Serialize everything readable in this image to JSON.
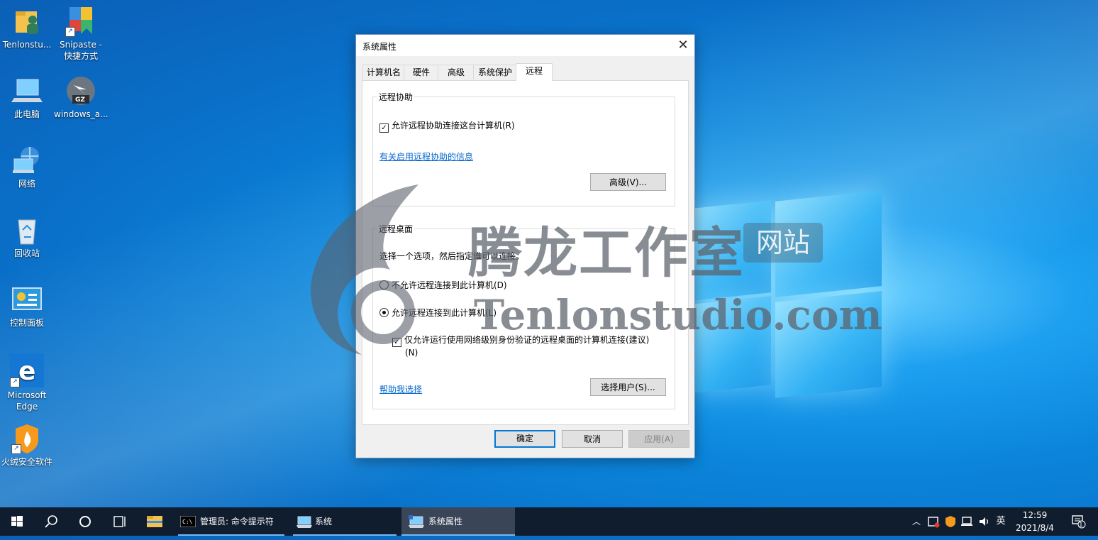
{
  "desktop": {
    "icons": [
      {
        "label": "Tenlonstu...",
        "icon": "user-folder-icon"
      },
      {
        "label": "Snipaste -\n快捷方式",
        "icon": "snipaste-icon"
      },
      {
        "label": "此电脑",
        "icon": "this-pc-icon"
      },
      {
        "label": "windows_a...",
        "icon": "gz-archive-icon"
      },
      {
        "label": "网络",
        "icon": "network-icon"
      },
      {
        "label": "回收站",
        "icon": "recycle-bin-icon"
      },
      {
        "label": "控制面板",
        "icon": "control-panel-icon"
      },
      {
        "label": "Microsoft\nEdge",
        "icon": "edge-icon"
      },
      {
        "label": "火绒安全软件",
        "icon": "huorong-icon"
      }
    ],
    "archive_badge": "GZ"
  },
  "watermark": {
    "chinese": "腾龙工作室",
    "badge": "网站",
    "english": "Tenlonstudio.com"
  },
  "dialog": {
    "title": "系统属性",
    "tabs": [
      "计算机名",
      "硬件",
      "高级",
      "系统保护",
      "远程"
    ],
    "active_tab": "远程",
    "remote_assistance": {
      "group_label": "远程协助",
      "allow_checkbox": "允许远程协助连接这台计算机(R)",
      "allow_checked": true,
      "info_link": "有关启用远程协助的信息",
      "advanced_button": "高级(V)..."
    },
    "remote_desktop": {
      "group_label": "远程桌面",
      "instruction": "选择一个选项，然后指定谁可以连接。",
      "option_disallow": "不允许远程连接到此计算机(D)",
      "option_allow": "允许远程连接到此计算机(L)",
      "selected": "allow",
      "nla_checkbox": "仅允许运行使用网络级别身份验证的远程桌面的计算机连接(建议)",
      "nla_checkbox_line2": "(N)",
      "nla_checked": true,
      "help_link": "帮助我选择",
      "select_users_button": "选择用户(S)..."
    },
    "buttons": {
      "ok": "确定",
      "cancel": "取消",
      "apply": "应用(A)"
    }
  },
  "taskbar": {
    "apps": [
      {
        "label": "管理员: 命令提示符",
        "icon": "cmd-icon"
      },
      {
        "label": "系统",
        "icon": "system-icon"
      },
      {
        "label": "系统属性",
        "icon": "system-properties-icon",
        "active": true
      }
    ],
    "ime": "英",
    "time": "12:59",
    "date": "2021/8/4",
    "notification_count": "1"
  }
}
